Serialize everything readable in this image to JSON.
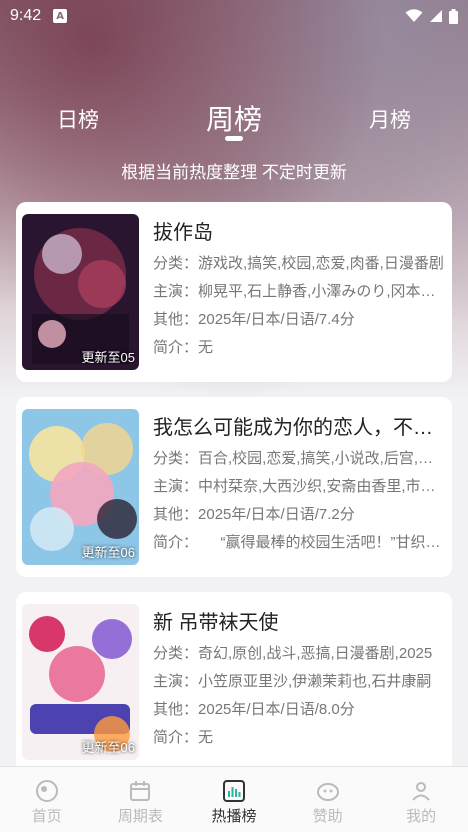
{
  "status_bar": {
    "time": "9:42",
    "notification_glyph": "A"
  },
  "header": {
    "tabs": [
      {
        "label": "日榜",
        "selected": false
      },
      {
        "label": "周榜",
        "selected": true
      },
      {
        "label": "月榜",
        "selected": false
      }
    ],
    "subtitle": "根据当前热度整理 不定时更新"
  },
  "labels": {
    "category": "分类：",
    "cast": "主演：",
    "other": "其他：",
    "intro": "简介："
  },
  "shows": [
    {
      "title": "拔作岛",
      "badge": "更新至05",
      "category": "游戏改,搞笑,校园,恋爱,肉番,日漫番剧",
      "cast": "柳晃平,石上静香,小澤みのり,冈本信彦",
      "other": "2025年/日本/日语/7.4分",
      "intro": "无",
      "cover_colors": [
        "#2a1530",
        "#7a2d4a",
        "#d8c8e0"
      ]
    },
    {
      "title": "我怎么可能成为你的恋人，不行不行！",
      "badge": "更新至06",
      "category": "百合,校园,恋爱,搞笑,小说改,后宫,日漫番剧",
      "cast": "中村栞奈,大西沙织,安斋由香里,市川太一",
      "other": "2025年/日本/日语/7.2分",
      "intro": "　　“赢得最棒的校园生活吧！”甘织玲奈子",
      "cover_colors": [
        "#8ec6e8",
        "#f4a6c0",
        "#f6e3a0"
      ]
    },
    {
      "title": "新 吊带袜天使",
      "badge": "更新至06",
      "category": "奇幻,原创,战斗,恶搞,日漫番剧,2025",
      "cast": "小笠原亚里沙,伊濑茉莉也,石井康嗣",
      "other": "2025年/日本/日语/8.0分",
      "intro": "无",
      "cover_colors": [
        "#f6f0f2",
        "#d4245a",
        "#3a2fa8"
      ]
    }
  ],
  "bottom_nav": [
    {
      "label": "首页",
      "icon": "home-icon",
      "active": false
    },
    {
      "label": "周期表",
      "icon": "calendar-icon",
      "active": false
    },
    {
      "label": "热播榜",
      "icon": "chart-icon",
      "active": true
    },
    {
      "label": "赞助",
      "icon": "sponsor-icon",
      "active": false
    },
    {
      "label": "我的",
      "icon": "profile-icon",
      "active": false
    }
  ]
}
